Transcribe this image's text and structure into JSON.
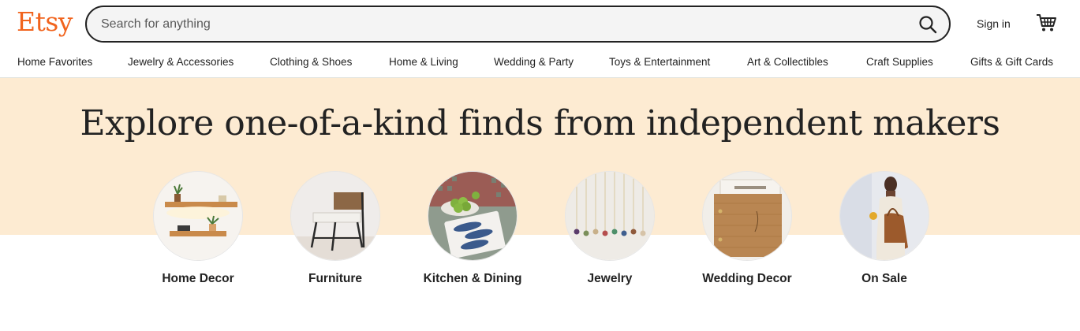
{
  "header": {
    "logo": "Etsy",
    "search_placeholder": "Search for anything",
    "sign_in": "Sign in",
    "icons": {
      "search": "search-icon",
      "cart": "cart-icon"
    }
  },
  "nav": {
    "items": [
      "Home Favorites",
      "Jewelry & Accessories",
      "Clothing & Shoes",
      "Home & Living",
      "Wedding & Party",
      "Toys & Entertainment",
      "Art & Collectibles",
      "Craft Supplies",
      "Gifts & Gift Cards"
    ]
  },
  "hero": {
    "title": "Explore one-of-a-kind finds from independent makers"
  },
  "categories": [
    {
      "label": "Home Decor"
    },
    {
      "label": "Furniture"
    },
    {
      "label": "Kitchen & Dining"
    },
    {
      "label": "Jewelry"
    },
    {
      "label": "Wedding Decor"
    },
    {
      "label": "On Sale"
    }
  ],
  "colors": {
    "brand": "#F1641E",
    "hero_bg": "#FDEBD2",
    "text": "#222222"
  }
}
